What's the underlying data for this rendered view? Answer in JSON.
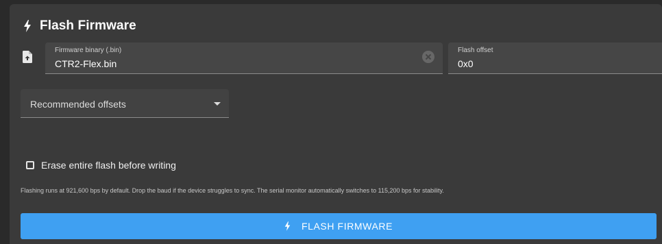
{
  "card": {
    "title": "Flash Firmware",
    "title_icon": "bolt-icon"
  },
  "binary": {
    "icon": "file-upload-icon",
    "label": "Firmware binary (.bin)",
    "value": "CTR2-Flex.bin",
    "clear_icon": "cancel-icon"
  },
  "offset": {
    "label": "Flash offset",
    "value": "0x0"
  },
  "recommended": {
    "label": "Recommended offsets",
    "caret_icon": "caret-down-icon"
  },
  "erase": {
    "label": "Erase entire flash before writing",
    "checked": false
  },
  "note": "Flashing runs at 921,600 bps by default. Drop the baud if the device struggles to sync. The serial monitor automatically switches to 115,200 bps for stability.",
  "button": {
    "label": "FLASH FIRMWARE",
    "icon": "bolt-icon"
  },
  "colors": {
    "background": "#2a2a2a",
    "card": "#3a3a3a",
    "accent": "#3fa0f2"
  }
}
